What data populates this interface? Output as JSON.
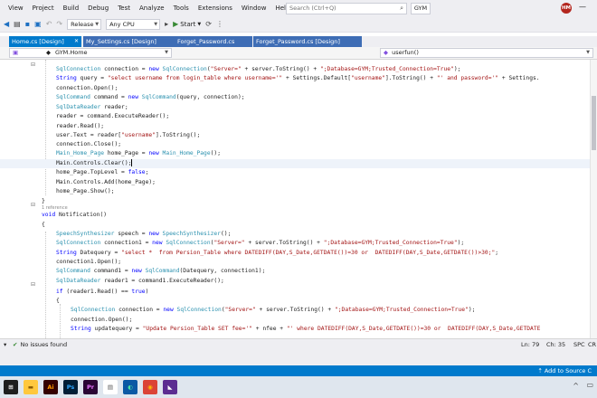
{
  "menu": {
    "items": [
      "View",
      "Project",
      "Build",
      "Debug",
      "Test",
      "Analyze",
      "Tools",
      "Extensions",
      "Window",
      "Help"
    ],
    "search_placeholder": "Search (Ctrl+Q)",
    "solution_name": "GYM",
    "avatar_initials": "HM"
  },
  "toolbar": {
    "configuration": "Release",
    "platform": "Any CPU",
    "start_label": "Start"
  },
  "tabs": [
    {
      "label": "Home.cs [Design]",
      "active": true
    },
    {
      "label": "My_Settings.cs [Design]",
      "active": false
    },
    {
      "label": "Forget_Password.cs",
      "active": false
    },
    {
      "label": "Forget_Password.cs [Design]",
      "active": false
    }
  ],
  "navbar": {
    "scope": "GYM.Home",
    "member": "userfun()"
  },
  "code": {
    "reference_hint": "1 reference",
    "lines": [
      [
        {
          "t": "t",
          "v": "SqlConnection"
        },
        {
          "t": "p",
          "v": " connection = "
        },
        {
          "t": "k",
          "v": "new"
        },
        {
          "t": "p",
          "v": " "
        },
        {
          "t": "t",
          "v": "SqlConnection"
        },
        {
          "t": "p",
          "v": "("
        },
        {
          "t": "s",
          "v": "\"Server=\""
        },
        {
          "t": "p",
          "v": " + server.ToString() + "
        },
        {
          "t": "s",
          "v": "\";Database=GYM;Trusted_Connection=True\""
        },
        {
          "t": "p",
          "v": ");"
        }
      ],
      [
        {
          "t": "k",
          "v": "String"
        },
        {
          "t": "p",
          "v": " query = "
        },
        {
          "t": "s",
          "v": "\"select username from login_table where username='\""
        },
        {
          "t": "p",
          "v": " + Settings.Default["
        },
        {
          "t": "s",
          "v": "\"username\""
        },
        {
          "t": "p",
          "v": "].ToString() + "
        },
        {
          "t": "s",
          "v": "\"' and password='\""
        },
        {
          "t": "p",
          "v": " + Settings."
        }
      ],
      [
        {
          "t": "p",
          "v": "connection.Open();"
        }
      ],
      [
        {
          "t": "t",
          "v": "SqlCommand"
        },
        {
          "t": "p",
          "v": " command = "
        },
        {
          "t": "k",
          "v": "new"
        },
        {
          "t": "p",
          "v": " "
        },
        {
          "t": "t",
          "v": "SqlCommand"
        },
        {
          "t": "p",
          "v": "(query, connection);"
        }
      ],
      [
        {
          "t": "t",
          "v": "SqlDataReader"
        },
        {
          "t": "p",
          "v": " reader;"
        }
      ],
      [
        {
          "t": "p",
          "v": "reader = command.ExecuteReader();"
        }
      ],
      [
        {
          "t": "p",
          "v": "reader.Read();"
        }
      ],
      [
        {
          "t": "p",
          "v": "user.Text = reader["
        },
        {
          "t": "s",
          "v": "\"username\""
        },
        {
          "t": "p",
          "v": "].ToString();"
        }
      ],
      [
        {
          "t": "p",
          "v": "connection.Close();"
        }
      ],
      [
        {
          "t": "t",
          "v": "Main_Home_Page"
        },
        {
          "t": "p",
          "v": " home_Page = "
        },
        {
          "t": "k",
          "v": "new"
        },
        {
          "t": "p",
          "v": " "
        },
        {
          "t": "t",
          "v": "Main_Home_Page"
        },
        {
          "t": "p",
          "v": "();"
        }
      ],
      [
        {
          "t": "p",
          "v": "Main.Controls.Clear();"
        }
      ],
      [
        {
          "t": "p",
          "v": "home_Page.TopLevel = "
        },
        {
          "t": "k",
          "v": "false"
        },
        {
          "t": "p",
          "v": ";"
        }
      ],
      [
        {
          "t": "p",
          "v": "Main.Controls.Add(home_Page);"
        }
      ],
      [
        {
          "t": "p",
          "v": "home_Page.Show();"
        }
      ],
      [
        {
          "t": "p",
          "v": "}"
        }
      ],
      [
        {
          "t": "k",
          "v": "void"
        },
        {
          "t": "p",
          "v": " Notification()"
        }
      ],
      [
        {
          "t": "p",
          "v": "{"
        }
      ],
      [
        {
          "t": "t",
          "v": "SpeechSynthesizer"
        },
        {
          "t": "p",
          "v": " speech = "
        },
        {
          "t": "k",
          "v": "new"
        },
        {
          "t": "p",
          "v": " "
        },
        {
          "t": "t",
          "v": "SpeechSynthesizer"
        },
        {
          "t": "p",
          "v": "();"
        }
      ],
      [
        {
          "t": "t",
          "v": "SqlConnection"
        },
        {
          "t": "p",
          "v": " connection1 = "
        },
        {
          "t": "k",
          "v": "new"
        },
        {
          "t": "p",
          "v": " "
        },
        {
          "t": "t",
          "v": "SqlConnection"
        },
        {
          "t": "p",
          "v": "("
        },
        {
          "t": "s",
          "v": "\"Server=\""
        },
        {
          "t": "p",
          "v": " + server.ToString() + "
        },
        {
          "t": "s",
          "v": "\";Database=GYM;Trusted_Connection=True\""
        },
        {
          "t": "p",
          "v": ");"
        }
      ],
      [
        {
          "t": "k",
          "v": "String"
        },
        {
          "t": "p",
          "v": " Datequery = "
        },
        {
          "t": "s",
          "v": "\"select *  from Persion_Table where DATEDIFF(DAY,S_Date,GETDATE())=30 or  DATEDIFF(DAY,S_Date,GETDATE())>30;\""
        },
        {
          "t": "p",
          "v": ";"
        }
      ],
      [
        {
          "t": "p",
          "v": "connection1.Open();"
        }
      ],
      [
        {
          "t": "t",
          "v": "SqlCommand"
        },
        {
          "t": "p",
          "v": " command1 = "
        },
        {
          "t": "k",
          "v": "new"
        },
        {
          "t": "p",
          "v": " "
        },
        {
          "t": "t",
          "v": "SqlCommand"
        },
        {
          "t": "p",
          "v": "(Datequery, connection1);"
        }
      ],
      [
        {
          "t": "t",
          "v": "SqlDataReader"
        },
        {
          "t": "p",
          "v": " reader1 = command1.ExecuteReader();"
        }
      ],
      [
        {
          "t": "k",
          "v": "if"
        },
        {
          "t": "p",
          "v": " (reader1.Read() == "
        },
        {
          "t": "k",
          "v": "true"
        },
        {
          "t": "p",
          "v": ")"
        }
      ],
      [
        {
          "t": "p",
          "v": "{"
        }
      ],
      [
        {
          "t": "t",
          "v": "SqlConnection"
        },
        {
          "t": "p",
          "v": " connection = "
        },
        {
          "t": "k",
          "v": "new"
        },
        {
          "t": "p",
          "v": " "
        },
        {
          "t": "t",
          "v": "SqlConnection"
        },
        {
          "t": "p",
          "v": "("
        },
        {
          "t": "s",
          "v": "\"Server=\""
        },
        {
          "t": "p",
          "v": " + server.ToString() + "
        },
        {
          "t": "s",
          "v": "\";Database=GYM;Trusted_Connection=True\""
        },
        {
          "t": "p",
          "v": ");"
        }
      ],
      [
        {
          "t": "p",
          "v": "connection.Open();"
        }
      ],
      [
        {
          "t": "k",
          "v": "String"
        },
        {
          "t": "p",
          "v": " updatequery = "
        },
        {
          "t": "s",
          "v": "\"Update Persion_Table SET fee='\""
        },
        {
          "t": "p",
          "v": " + nfee + "
        },
        {
          "t": "s",
          "v": "\"' where DATEDIFF(DAY,S_Date,GETDATE())=30 or  DATEDIFF(DAY,S_Date,GETDATE"
        }
      ]
    ]
  },
  "status": {
    "issues": "No issues found",
    "line": "Ln: 79",
    "col": "Ch: 35",
    "mode": "SPC",
    "eol": "CR"
  },
  "bottom": {
    "add_to_source": "Add to Source C"
  },
  "taskbar": {
    "apps": [
      {
        "name": "windows-start",
        "label": "",
        "bg": "#1e1e1e",
        "fg": "#ffffff"
      },
      {
        "name": "file-explorer",
        "label": "",
        "bg": "#ffc83d",
        "fg": "#8a5a00"
      },
      {
        "name": "illustrator",
        "label": "Ai",
        "bg": "#330000",
        "fg": "#ff9a00"
      },
      {
        "name": "photoshop",
        "label": "Ps",
        "bg": "#001e36",
        "fg": "#31a8ff"
      },
      {
        "name": "premiere",
        "label": "Pr",
        "bg": "#2a0634",
        "fg": "#ea77ff"
      },
      {
        "name": "notepad",
        "label": "",
        "bg": "#ffffff",
        "fg": "#555555"
      },
      {
        "name": "edge",
        "label": "",
        "bg": "#0c59a4",
        "fg": "#4be0a0"
      },
      {
        "name": "chrome",
        "label": "",
        "bg": "#db4437",
        "fg": "#fbbc05"
      },
      {
        "name": "visual-studio",
        "label": "",
        "bg": "#5c2d91",
        "fg": "#ffffff"
      }
    ]
  },
  "colors": {
    "accent": "#007acc",
    "keyword": "#0000ff",
    "type": "#2b91af",
    "string": "#a31515"
  }
}
